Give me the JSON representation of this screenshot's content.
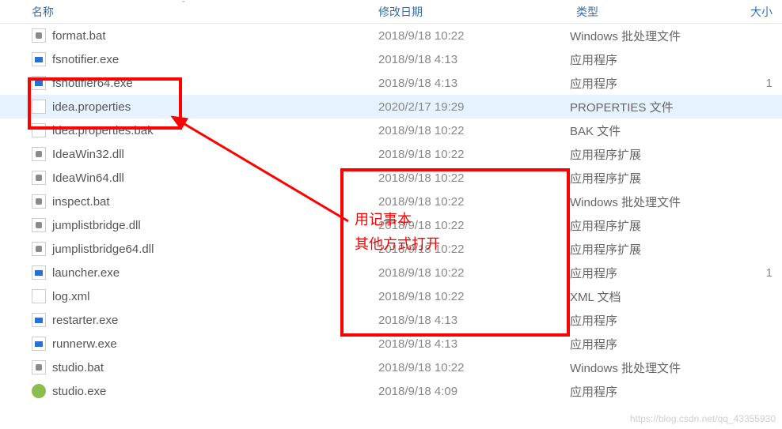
{
  "columns": {
    "name": "名称",
    "date": "修改日期",
    "type": "类型",
    "size": "大小"
  },
  "sort_indicator": "ˇ",
  "files": [
    {
      "name": "format.bat",
      "date": "2018/9/18 10:22",
      "type": "Windows 批处理文件",
      "size": "",
      "icon": "bat"
    },
    {
      "name": "fsnotifier.exe",
      "date": "2018/9/18 4:13",
      "type": "应用程序",
      "size": "",
      "icon": "exe"
    },
    {
      "name": "fsnotifier64.exe",
      "date": "2018/9/18 4:13",
      "type": "应用程序",
      "size": "1",
      "icon": "exe"
    },
    {
      "name": "idea.properties",
      "date": "2020/2/17 19:29",
      "type": "PROPERTIES 文件",
      "size": "",
      "icon": "file",
      "selected": true
    },
    {
      "name": "idea.properties.bak",
      "date": "2018/9/18 10:22",
      "type": "BAK 文件",
      "size": "",
      "icon": "file"
    },
    {
      "name": "IdeaWin32.dll",
      "date": "2018/9/18 10:22",
      "type": "应用程序扩展",
      "size": "",
      "icon": "dll"
    },
    {
      "name": "IdeaWin64.dll",
      "date": "2018/9/18 10:22",
      "type": "应用程序扩展",
      "size": "",
      "icon": "dll"
    },
    {
      "name": "inspect.bat",
      "date": "2018/9/18 10:22",
      "type": "Windows 批处理文件",
      "size": "",
      "icon": "bat"
    },
    {
      "name": "jumplistbridge.dll",
      "date": "2018/9/18 10:22",
      "type": "应用程序扩展",
      "size": "",
      "icon": "dll"
    },
    {
      "name": "jumplistbridge64.dll",
      "date": "2018/9/18 10:22",
      "type": "应用程序扩展",
      "size": "",
      "icon": "dll"
    },
    {
      "name": "launcher.exe",
      "date": "2018/9/18 10:22",
      "type": "应用程序",
      "size": "1",
      "icon": "exe"
    },
    {
      "name": "log.xml",
      "date": "2018/9/18 10:22",
      "type": "XML 文档",
      "size": "",
      "icon": "xml"
    },
    {
      "name": "restarter.exe",
      "date": "2018/9/18 4:13",
      "type": "应用程序",
      "size": "",
      "icon": "exe"
    },
    {
      "name": "runnerw.exe",
      "date": "2018/9/18 4:13",
      "type": "应用程序",
      "size": "",
      "icon": "exe"
    },
    {
      "name": "studio.bat",
      "date": "2018/9/18 10:22",
      "type": "Windows 批处理文件",
      "size": "",
      "icon": "bat"
    },
    {
      "name": "studio.exe",
      "date": "2018/9/18 4:09",
      "type": "应用程序",
      "size": "",
      "icon": "studio"
    }
  ],
  "annotation": {
    "line1": "用记事本",
    "line2": "其他方式打开"
  },
  "watermark": "https://blog.csdn.net/qq_43355930"
}
